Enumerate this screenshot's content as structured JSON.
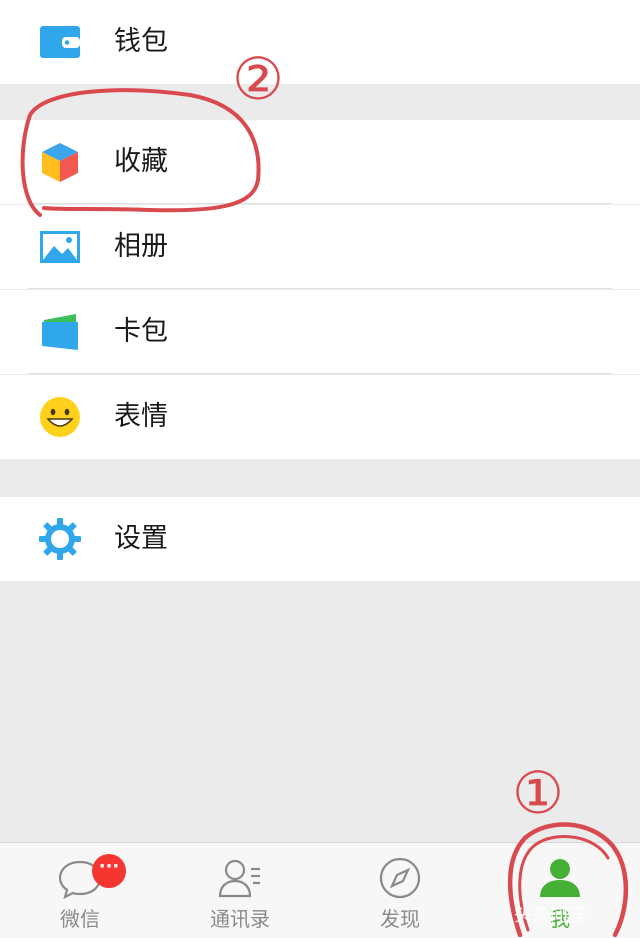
{
  "menu": {
    "items": [
      {
        "label": "钱包",
        "icon": "wallet-icon"
      },
      {
        "label": "收藏",
        "icon": "favorites-cube-icon"
      },
      {
        "label": "相册",
        "icon": "album-icon"
      },
      {
        "label": "卡包",
        "icon": "card-wallet-icon"
      },
      {
        "label": "表情",
        "icon": "sticker-smiley-icon"
      },
      {
        "label": "设置",
        "icon": "settings-gear-icon"
      }
    ]
  },
  "tabbar": {
    "tabs": [
      {
        "label": "微信",
        "icon": "chats-icon",
        "badge": "···"
      },
      {
        "label": "通讯录",
        "icon": "contacts-icon"
      },
      {
        "label": "发现",
        "icon": "discover-compass-icon"
      },
      {
        "label": "我",
        "icon": "me-person-icon",
        "active": true
      }
    ]
  },
  "annotations": {
    "mark_1": "①",
    "mark_2": "②"
  },
  "watermark": "头条问答",
  "colors": {
    "accent_green": "#45b035",
    "badge_red": "#f43530",
    "icon_blue": "#2fa7ea",
    "annotation_red": "#d94a4f",
    "background": "#ebebeb"
  }
}
